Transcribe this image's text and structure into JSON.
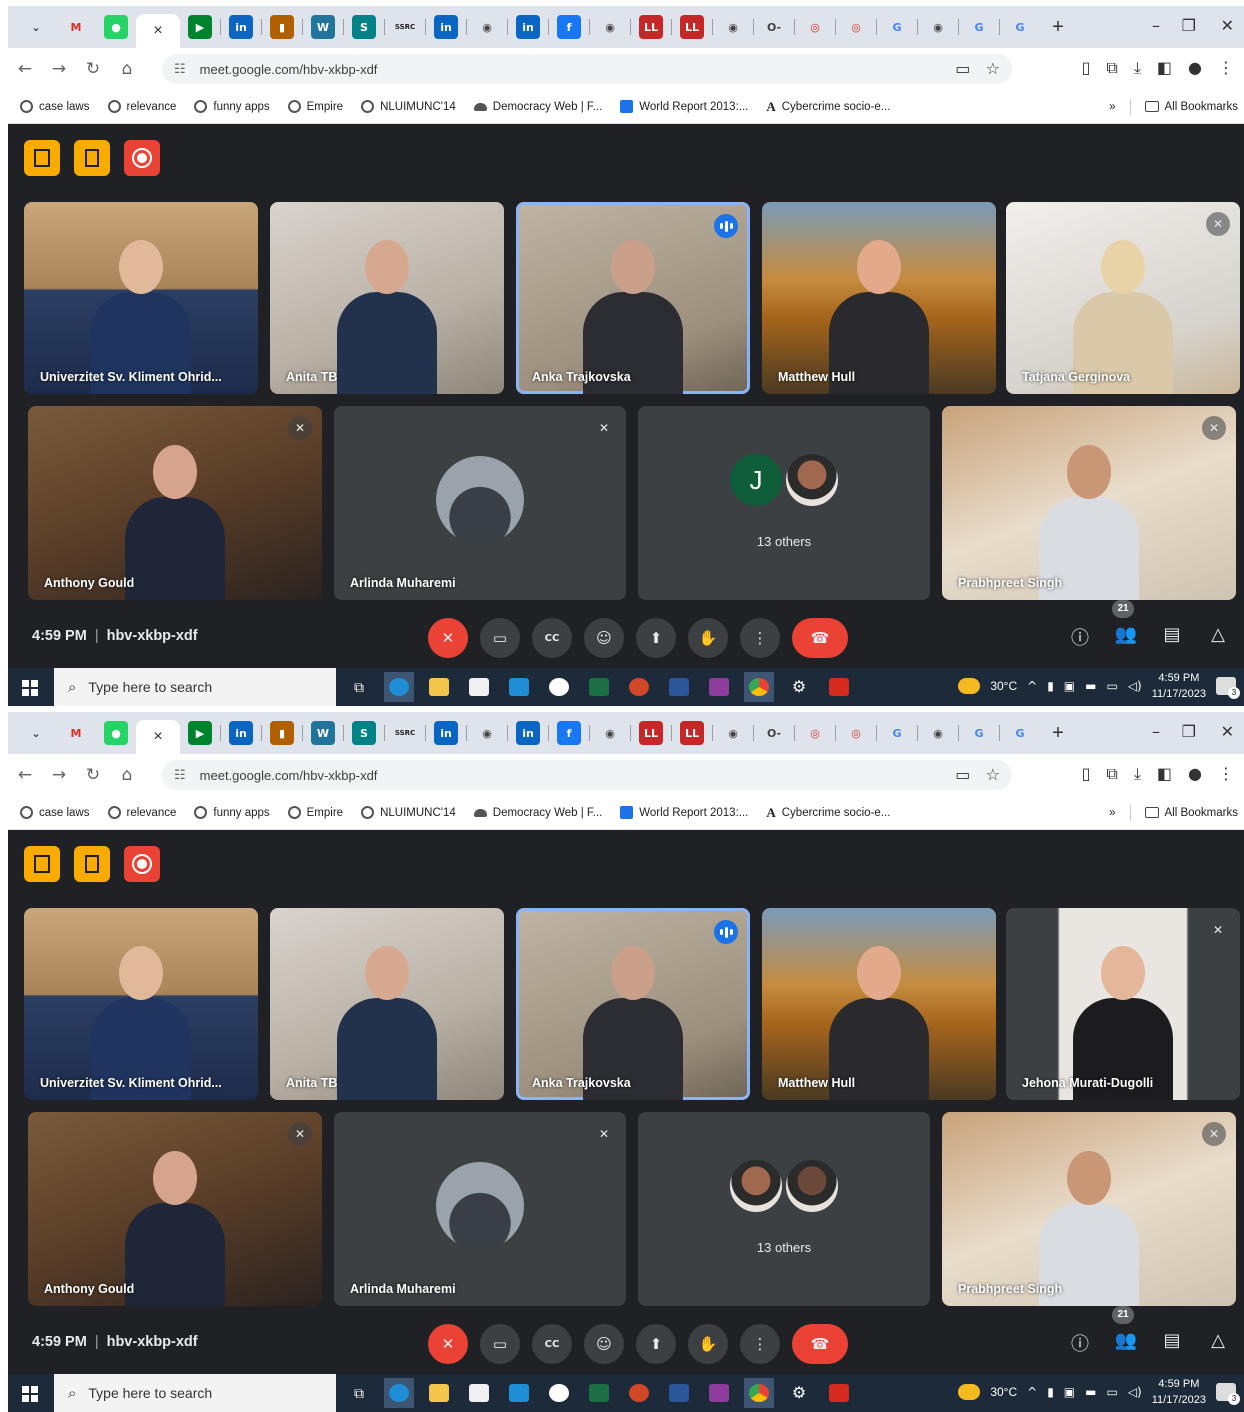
{
  "screenshots": [
    {
      "browser": {
        "url": "meet.google.com/hbv-xkbp-xdf",
        "tabs": [
          {
            "icon": "chevron-down-icon",
            "glyph": "⌄",
            "color": "#dfe3eb",
            "fg": "#333"
          },
          {
            "icon": "gmail-icon",
            "glyph": "M",
            "color": "#dfe3eb",
            "fg": "#d93025"
          },
          {
            "icon": "whatsapp-icon",
            "glyph": "●",
            "color": "#25d366",
            "fg": "#fff"
          },
          {
            "icon": "meet-icon",
            "glyph": "▶",
            "color": "#00832d",
            "fg": "#fff"
          },
          {
            "icon": "linkedin-icon",
            "glyph": "in",
            "color": "#0a66c2",
            "fg": "#fff"
          },
          {
            "icon": "bookmark-icon",
            "glyph": "▮",
            "color": "#b06000",
            "fg": "#fff"
          },
          {
            "icon": "wordpress-icon",
            "glyph": "W",
            "color": "#21759b",
            "fg": "#fff"
          },
          {
            "icon": "sharepoint-icon",
            "glyph": "S",
            "color": "#038387",
            "fg": "#fff"
          },
          {
            "icon": "ssrc-icon",
            "glyph": "SSRC",
            "color": "#dfe3eb",
            "fg": "#222"
          },
          {
            "icon": "linkedin-icon",
            "glyph": "in",
            "color": "#0a66c2",
            "fg": "#fff"
          },
          {
            "icon": "globe-icon",
            "glyph": "◉",
            "color": "#dfe3eb",
            "fg": "#444"
          },
          {
            "icon": "linkedin-icon",
            "glyph": "in",
            "color": "#0a66c2",
            "fg": "#fff"
          },
          {
            "icon": "facebook-icon",
            "glyph": "f",
            "color": "#1877f2",
            "fg": "#fff"
          },
          {
            "icon": "globe-icon",
            "glyph": "◉",
            "color": "#dfe3eb",
            "fg": "#444"
          },
          {
            "icon": "livelaw-icon",
            "glyph": "LL",
            "color": "#c62828",
            "fg": "#fff"
          },
          {
            "icon": "livelaw-icon",
            "glyph": "LL",
            "color": "#c62828",
            "fg": "#fff"
          },
          {
            "icon": "globe-icon",
            "glyph": "◉",
            "color": "#dfe3eb",
            "fg": "#444"
          },
          {
            "icon": "key-icon",
            "glyph": "O-",
            "color": "#dfe3eb",
            "fg": "#444"
          },
          {
            "icon": "target-icon",
            "glyph": "◎",
            "color": "#dfe3eb",
            "fg": "#d93025"
          },
          {
            "icon": "target-icon",
            "glyph": "◎",
            "color": "#dfe3eb",
            "fg": "#d93025"
          },
          {
            "icon": "google-icon",
            "glyph": "G",
            "color": "#dfe3eb",
            "fg": "#4285f4"
          },
          {
            "icon": "globe-icon",
            "glyph": "◉",
            "color": "#dfe3eb",
            "fg": "#444"
          },
          {
            "icon": "google-icon",
            "glyph": "G",
            "color": "#dfe3eb",
            "fg": "#4285f4"
          },
          {
            "icon": "google-icon",
            "glyph": "G",
            "color": "#dfe3eb",
            "fg": "#4285f4"
          }
        ],
        "active_tab_close": "×",
        "new_tab": "+",
        "bookmarks": [
          {
            "icon": "globe-icon",
            "style": "",
            "label": "case laws"
          },
          {
            "icon": "globe-icon",
            "style": "",
            "label": "relevance"
          },
          {
            "icon": "globe-icon",
            "style": "",
            "label": "funny apps"
          },
          {
            "icon": "globe-icon",
            "style": "",
            "label": "Empire"
          },
          {
            "icon": "globe-icon",
            "style": "",
            "label": "NLUIMUNC'14"
          },
          {
            "icon": "cloud-icon",
            "style": "dem",
            "label": "Democracy Web | F..."
          },
          {
            "icon": "document-icon",
            "style": "blue",
            "label": "World Report 2013:..."
          },
          {
            "icon": "letter-a-icon",
            "style": "A",
            "label": "Cybercrime socio-e..."
          }
        ],
        "bookmarks_overflow": "»",
        "all_bookmarks": "All Bookmarks"
      },
      "meet": {
        "time": "4:59 PM",
        "meeting_code": "hbv-xkbp-xdf",
        "participant_count": "21",
        "tiles": [
          {
            "name": "Univerzitet Sv. Kliment Ohrid...",
            "kind": "video",
            "muted": false,
            "speaking": false,
            "bg": "linear-gradient(180deg,#c9a57a 0%,#a88458 45%,#2c3e63 46%,#1e2c4c 100%)",
            "head": "#e0b89a",
            "shirt": "#1f3560"
          },
          {
            "name": "Anita TB",
            "kind": "video",
            "muted": false,
            "speaking": false,
            "bg": "linear-gradient(160deg,#d8d3cc 0%,#b9b1a6 60%,#8f877c 100%)",
            "head": "#d7a890",
            "shirt": "#22324d"
          },
          {
            "name": "Anka Trajkovska",
            "kind": "video",
            "muted": false,
            "speaking": true,
            "bg": "linear-gradient(160deg,#bfb4a4 0%,#9c8f7d 70%,#6e6556 100%)",
            "head": "#caa08a",
            "shirt": "#2c2c33"
          },
          {
            "name": "Matthew Hull",
            "kind": "video",
            "muted": false,
            "speaking": false,
            "bg": "linear-gradient(180deg,#7a9bb8 0%,#c68c3f 40%,#a6651c 60%,#4a3a22 100%)",
            "head": "#e2a98a",
            "shirt": "#2a2a2e"
          },
          {
            "name": "Tatjana Gerginova",
            "kind": "video",
            "muted": true,
            "speaking": false,
            "bg": "linear-gradient(160deg,#f1efec 0%,#d6d2cc 70%,#c9b79a 100%)",
            "head": "#e8d3a8",
            "shirt": "#d9c9a9"
          },
          {
            "name": "Anthony Gould",
            "kind": "video",
            "muted": true,
            "speaking": false,
            "bg": "linear-gradient(160deg,#7a5a3a 0%,#5a3e28 50%,#2b2320 100%)",
            "head": "#d6a48c",
            "shirt": "#1e2638"
          },
          {
            "name": "Arlinda Muharemi",
            "kind": "avatar",
            "muted": true,
            "speaking": false
          },
          {
            "kind": "others",
            "others_label": "13 others",
            "avatars": [
              {
                "type": "letter",
                "letter": "J"
              },
              {
                "type": "photo",
                "color": "#a0684f"
              }
            ]
          },
          {
            "name": "Prabhpreet Singh",
            "kind": "video",
            "muted": true,
            "speaking": false,
            "bg": "linear-gradient(160deg,#c8a27a 0%,#e8dccb 50%,#cfc4b2 100%)",
            "head": "#c99676",
            "shirt": "#d9dde2"
          }
        ]
      },
      "taskbar": {
        "search_placeholder": "Type here to search",
        "temperature": "30°C",
        "time": "4:59 PM",
        "date": "11/17/2023",
        "notifications": "3"
      }
    },
    {
      "browser": {
        "url": "meet.google.com/hbv-xkbp-xdf",
        "tabs": [
          {
            "icon": "chevron-down-icon",
            "glyph": "⌄",
            "color": "#dfe3eb",
            "fg": "#333"
          },
          {
            "icon": "gmail-icon",
            "glyph": "M",
            "color": "#dfe3eb",
            "fg": "#d93025"
          },
          {
            "icon": "whatsapp-icon",
            "glyph": "●",
            "color": "#25d366",
            "fg": "#fff"
          },
          {
            "icon": "meet-icon",
            "glyph": "▶",
            "color": "#00832d",
            "fg": "#fff"
          },
          {
            "icon": "linkedin-icon",
            "glyph": "in",
            "color": "#0a66c2",
            "fg": "#fff"
          },
          {
            "icon": "bookmark-icon",
            "glyph": "▮",
            "color": "#b06000",
            "fg": "#fff"
          },
          {
            "icon": "wordpress-icon",
            "glyph": "W",
            "color": "#21759b",
            "fg": "#fff"
          },
          {
            "icon": "sharepoint-icon",
            "glyph": "S",
            "color": "#038387",
            "fg": "#fff"
          },
          {
            "icon": "ssrc-icon",
            "glyph": "SSRC",
            "color": "#dfe3eb",
            "fg": "#222"
          },
          {
            "icon": "linkedin-icon",
            "glyph": "in",
            "color": "#0a66c2",
            "fg": "#fff"
          },
          {
            "icon": "globe-icon",
            "glyph": "◉",
            "color": "#dfe3eb",
            "fg": "#444"
          },
          {
            "icon": "linkedin-icon",
            "glyph": "in",
            "color": "#0a66c2",
            "fg": "#fff"
          },
          {
            "icon": "facebook-icon",
            "glyph": "f",
            "color": "#1877f2",
            "fg": "#fff"
          },
          {
            "icon": "globe-icon",
            "glyph": "◉",
            "color": "#dfe3eb",
            "fg": "#444"
          },
          {
            "icon": "livelaw-icon",
            "glyph": "LL",
            "color": "#c62828",
            "fg": "#fff"
          },
          {
            "icon": "livelaw-icon",
            "glyph": "LL",
            "color": "#c62828",
            "fg": "#fff"
          },
          {
            "icon": "globe-icon",
            "glyph": "◉",
            "color": "#dfe3eb",
            "fg": "#444"
          },
          {
            "icon": "key-icon",
            "glyph": "O-",
            "color": "#dfe3eb",
            "fg": "#444"
          },
          {
            "icon": "target-icon",
            "glyph": "◎",
            "color": "#dfe3eb",
            "fg": "#d93025"
          },
          {
            "icon": "target-icon",
            "glyph": "◎",
            "color": "#dfe3eb",
            "fg": "#d93025"
          },
          {
            "icon": "google-icon",
            "glyph": "G",
            "color": "#dfe3eb",
            "fg": "#4285f4"
          },
          {
            "icon": "globe-icon",
            "glyph": "◉",
            "color": "#dfe3eb",
            "fg": "#444"
          },
          {
            "icon": "google-icon",
            "glyph": "G",
            "color": "#dfe3eb",
            "fg": "#4285f4"
          },
          {
            "icon": "google-icon",
            "glyph": "G",
            "color": "#dfe3eb",
            "fg": "#4285f4"
          }
        ],
        "active_tab_close": "×",
        "new_tab": "+",
        "bookmarks": [
          {
            "icon": "globe-icon",
            "style": "",
            "label": "case laws"
          },
          {
            "icon": "globe-icon",
            "style": "",
            "label": "relevance"
          },
          {
            "icon": "globe-icon",
            "style": "",
            "label": "funny apps"
          },
          {
            "icon": "globe-icon",
            "style": "",
            "label": "Empire"
          },
          {
            "icon": "globe-icon",
            "style": "",
            "label": "NLUIMUNC'14"
          },
          {
            "icon": "cloud-icon",
            "style": "dem",
            "label": "Democracy Web | F..."
          },
          {
            "icon": "document-icon",
            "style": "blue",
            "label": "World Report 2013:..."
          },
          {
            "icon": "letter-a-icon",
            "style": "A",
            "label": "Cybercrime socio-e..."
          }
        ],
        "bookmarks_overflow": "»",
        "all_bookmarks": "All Bookmarks"
      },
      "meet": {
        "time": "4:59 PM",
        "meeting_code": "hbv-xkbp-xdf",
        "participant_count": "21",
        "tiles": [
          {
            "name": "Univerzitet Sv. Kliment Ohrid...",
            "kind": "video",
            "muted": false,
            "speaking": false,
            "bg": "linear-gradient(180deg,#c9a57a 0%,#a88458 45%,#2c3e63 46%,#1e2c4c 100%)",
            "head": "#e0b89a",
            "shirt": "#1f3560"
          },
          {
            "name": "Anita TB",
            "kind": "video",
            "muted": false,
            "speaking": false,
            "bg": "linear-gradient(160deg,#d8d3cc 0%,#b9b1a6 60%,#8f877c 100%)",
            "head": "#d7a890",
            "shirt": "#22324d"
          },
          {
            "name": "Anka Trajkovska",
            "kind": "video",
            "muted": false,
            "speaking": true,
            "bg": "linear-gradient(160deg,#bfb4a4 0%,#9c8f7d 70%,#6e6556 100%)",
            "head": "#caa08a",
            "shirt": "#2c2c33"
          },
          {
            "name": "Matthew Hull",
            "kind": "video",
            "muted": false,
            "speaking": false,
            "bg": "linear-gradient(180deg,#7a9bb8 0%,#c68c3f 40%,#a6651c 60%,#4a3a22 100%)",
            "head": "#e2a98a",
            "shirt": "#2a2a2e"
          },
          {
            "name": "Jehona Murati-Dugolli",
            "kind": "video",
            "muted": true,
            "speaking": false,
            "bg": "linear-gradient(90deg,#3c4043 0%,#3c4043 22%,#e9e6e1 23%,#e9e6e1 77%,#3c4043 78%,#3c4043 100%)",
            "head": "#e4b79a",
            "shirt": "#1c1c1f"
          },
          {
            "name": "Anthony Gould",
            "kind": "video",
            "muted": true,
            "speaking": false,
            "bg": "linear-gradient(160deg,#7a5a3a 0%,#5a3e28 50%,#2b2320 100%)",
            "head": "#d6a48c",
            "shirt": "#1e2638"
          },
          {
            "name": "Arlinda Muharemi",
            "kind": "avatar",
            "muted": true,
            "speaking": false
          },
          {
            "kind": "others",
            "others_label": "13 others",
            "avatars": [
              {
                "type": "photo",
                "color": "#a0684f"
              },
              {
                "type": "photo",
                "color": "#6b4a3a"
              }
            ]
          },
          {
            "name": "Prabhpreet Singh",
            "kind": "video",
            "muted": true,
            "speaking": false,
            "bg": "linear-gradient(160deg,#c8a27a 0%,#e8dccb 50%,#cfc4b2 100%)",
            "head": "#c99676",
            "shirt": "#d9dde2"
          }
        ]
      },
      "taskbar": {
        "search_placeholder": "Type here to search",
        "temperature": "30°C",
        "time": "4:59 PM",
        "date": "11/17/2023",
        "notifications": "3"
      }
    }
  ]
}
